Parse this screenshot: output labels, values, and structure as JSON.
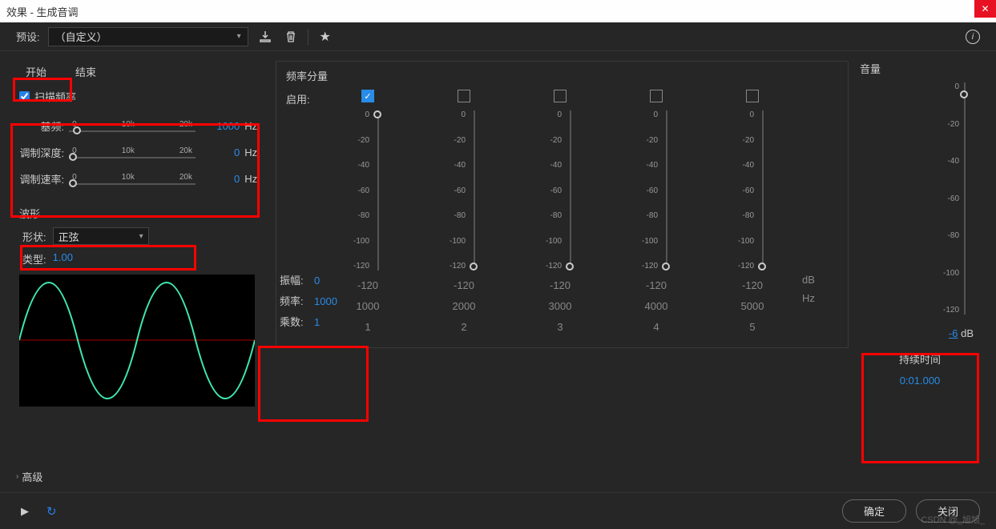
{
  "window": {
    "title": "效果 - 生成音调"
  },
  "preset": {
    "label": "预设:",
    "value": "（自定义）"
  },
  "tabs": {
    "start": "开始",
    "end": "结束"
  },
  "sweep": {
    "label": "扫描频率"
  },
  "sliders": {
    "base": {
      "label": "基频:",
      "t0": "0",
      "t1": "10k",
      "t2": "20k",
      "value": "1000",
      "unit": "Hz"
    },
    "modDepth": {
      "label": "调制深度:",
      "t0": "0",
      "t1": "10k",
      "t2": "20k",
      "value": "0",
      "unit": "Hz"
    },
    "modRate": {
      "label": "调制速率:",
      "t0": "0",
      "t1": "10k",
      "t2": "20k",
      "value": "0",
      "unit": "Hz"
    }
  },
  "waveform": {
    "section": "波形",
    "shapeLabel": "形状:",
    "shapeValue": "正弦",
    "typeLabel": "类型:",
    "typeValue": "1.00"
  },
  "freq": {
    "title": "频率分量",
    "enableLabel": "启用:",
    "ticks": [
      "0",
      "-20",
      "-40",
      "-60",
      "-80",
      "-100",
      "-120"
    ],
    "cols": [
      {
        "checked": true,
        "amp": "-120",
        "hz": "1000",
        "mult": "1"
      },
      {
        "checked": false,
        "amp": "-120",
        "hz": "2000",
        "mult": "2"
      },
      {
        "checked": false,
        "amp": "-120",
        "hz": "3000",
        "mult": "3"
      },
      {
        "checked": false,
        "amp": "-120",
        "hz": "4000",
        "mult": "4"
      },
      {
        "checked": false,
        "amp": "-120",
        "hz": "5000",
        "mult": "5"
      }
    ],
    "unitDb": "dB",
    "unitHz": "Hz"
  },
  "params": {
    "ampLabel": "振幅:",
    "ampValue": "0",
    "freqLabel": "频率:",
    "freqValue": "1000",
    "multLabel": "乘数:",
    "multValue": "1"
  },
  "volume": {
    "title": "音量",
    "ticks": [
      "0",
      "-20",
      "-40",
      "-60",
      "-80",
      "-100",
      "-120"
    ],
    "value": "-6",
    "unit": "dB"
  },
  "duration": {
    "label": "持续时间",
    "value": "0:01.000"
  },
  "advanced": "高级",
  "footer": {
    "ok": "确定",
    "close": "关闭"
  },
  "watermark": "CSDN @_旭旭_"
}
